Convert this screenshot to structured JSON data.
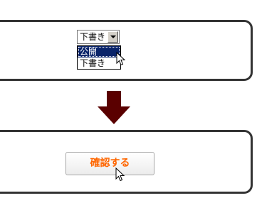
{
  "visibility_select": {
    "selected_value": "下書き",
    "options": [
      {
        "label": "公開",
        "highlighted": true
      },
      {
        "label": "下書き",
        "highlighted": false
      }
    ]
  },
  "confirm_button": {
    "label": "確認する"
  },
  "colors": {
    "panel_border": "#333333",
    "arrow": "#5a0000",
    "highlight": "#0a246a",
    "button_text": "#ff6600"
  },
  "icons": {
    "down_arrow": "down-arrow-icon",
    "cursor": "mouse-cursor-icon"
  }
}
